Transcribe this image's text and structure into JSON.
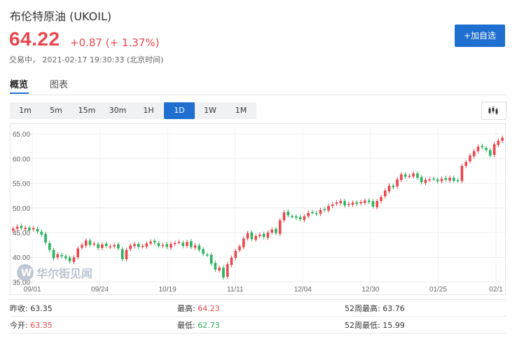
{
  "header": {
    "title": "布伦特原油 (UKOIL)",
    "price": "64.22",
    "change": "+0.87 (+ 1.37%)",
    "status": "交易中， 2021-02-17 19:30:33 (北京时间)",
    "add_button": "+加自选"
  },
  "tabs": [
    {
      "label": "概览",
      "active": true
    },
    {
      "label": "图表",
      "active": false
    }
  ],
  "ranges": [
    {
      "label": "1m"
    },
    {
      "label": "5m"
    },
    {
      "label": "15m"
    },
    {
      "label": "30m"
    },
    {
      "label": "1H"
    },
    {
      "label": "1D"
    },
    {
      "label": "1W"
    },
    {
      "label": "1M"
    }
  ],
  "active_range": "1D",
  "chart_type_icon": "candlestick-icon",
  "watermark": "华尔街见闻",
  "colors": {
    "up": "#e9474d",
    "down": "#2bb35f",
    "accent": "#1f6fd1"
  },
  "chart_data": {
    "type": "candlestick",
    "yticks": [
      "65.00",
      "60.00",
      "55.00",
      "50.00",
      "45.00",
      "40.00",
      "35.00"
    ],
    "ylim": [
      34.5,
      66
    ],
    "xticks": [
      "09/01",
      "09/24",
      "10/19",
      "11/11",
      "12/04",
      "12/30",
      "01/25",
      "02/1"
    ],
    "grid": true,
    "closes": [
      45.8,
      46.2,
      45.9,
      46.0,
      45.5,
      45.9,
      45.2,
      44.6,
      43.0,
      41.5,
      39.8,
      40.6,
      40.2,
      39.8,
      39.2,
      40.0,
      41.8,
      42.5,
      43.4,
      42.5,
      42.8,
      41.9,
      42.6,
      42.3,
      42.2,
      42.5,
      41.8,
      39.6,
      41.5,
      42.4,
      42.7,
      42.1,
      42.3,
      42.8,
      43.2,
      43.0,
      42.3,
      42.5,
      42.1,
      42.7,
      42.9,
      43.1,
      42.3,
      43.1,
      42.1,
      42.4,
      41.5,
      40.7,
      40.5,
      38.7,
      37.5,
      37.9,
      35.9,
      38.6,
      39.9,
      41.3,
      42.2,
      43.8,
      44.9,
      43.7,
      44.3,
      44.6,
      44.1,
      45.0,
      45.6,
      44.9,
      47.5,
      49.1,
      48.5,
      48.3,
      48.0,
      47.7,
      48.3,
      49.0,
      49.1,
      48.8,
      49.6,
      49.6,
      50.4,
      50.7,
      51.1,
      51.4,
      50.5,
      50.8,
      51.1,
      50.8,
      51.2,
      51.5,
      51.2,
      50.3,
      51.4,
      52.2,
      53.5,
      54.5,
      54.2,
      55.8,
      56.8,
      56.3,
      56.5,
      57.0,
      56.1,
      55.2,
      55.7,
      55.8,
      55.9,
      55.4,
      55.9,
      55.7,
      56.1,
      55.5,
      55.6,
      58.5,
      59.3,
      60.6,
      61.5,
      62.4,
      62.3,
      61.7,
      60.6,
      62.9,
      63.6,
      64.2
    ]
  },
  "stats": [
    [
      {
        "label": "昨收:",
        "value": "63.35",
        "tone": "neutral"
      },
      {
        "label": "最高:",
        "value": "64.23",
        "tone": "up"
      },
      {
        "label": "52周最高:",
        "value": "63.76",
        "tone": "neutral"
      }
    ],
    [
      {
        "label": "今开:",
        "value": "63.35",
        "tone": "up"
      },
      {
        "label": "最低:",
        "value": "62.73",
        "tone": "down"
      },
      {
        "label": "52周最低:",
        "value": "15.99",
        "tone": "neutral"
      }
    ]
  ]
}
